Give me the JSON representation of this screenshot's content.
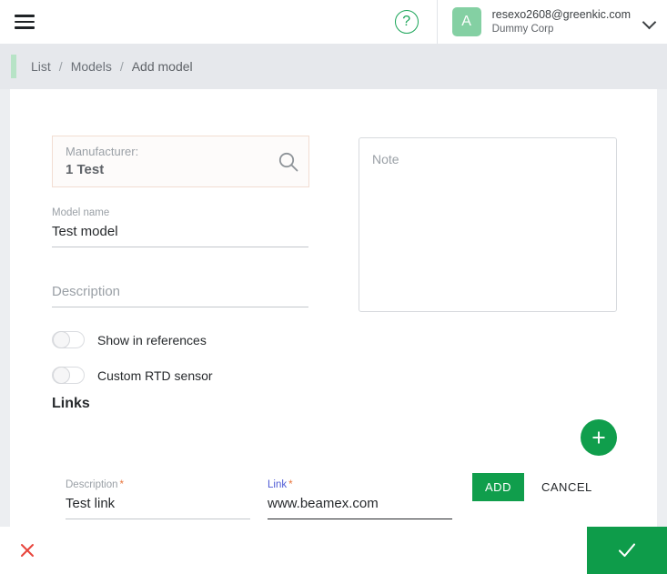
{
  "colors": {
    "brand_green": "#109e4c",
    "avatar_green": "#84d0a3",
    "accent_bar": "#b7e3c6",
    "focus_indigo": "#4f5bd5",
    "required_orange": "#e8743b",
    "danger_red": "#e8453c",
    "manufacturer_border": "#f2ddd2"
  },
  "topbar": {
    "menu_icon": "hamburger-menu-icon",
    "help_icon": "help-circle-icon",
    "help_glyph": "?",
    "avatar_initial": "A",
    "user_email": "resexo2608@greenkic.com",
    "user_org": "Dummy Corp",
    "caret_icon": "chevron-down-icon"
  },
  "breadcrumb": {
    "items": [
      {
        "label": "List"
      },
      {
        "label": "Models"
      },
      {
        "label": "Add model"
      }
    ],
    "separator": "/"
  },
  "form": {
    "manufacturer": {
      "label": "Manufacturer:",
      "value": "1 Test",
      "search_icon": "search-icon"
    },
    "model_name": {
      "label": "Model name",
      "value": "Test model",
      "placeholder": "Model name"
    },
    "description": {
      "label": "",
      "value": "Description",
      "placeholder": "Description"
    },
    "toggles": [
      {
        "label": "Show in references",
        "state": "off"
      },
      {
        "label": "Custom RTD sensor",
        "state": "off"
      }
    ],
    "links_heading": "Links",
    "note": {
      "placeholder": "Note",
      "value": ""
    },
    "add_link_fab": {
      "icon": "plus-icon",
      "label": "+"
    },
    "link_entry": {
      "description": {
        "label": "Description",
        "required_marker": "*",
        "value": "Test link"
      },
      "link": {
        "label": "Link",
        "required_marker": "*",
        "value": "www.beamex.com",
        "focused": true
      },
      "add_button": "ADD",
      "cancel_button": "CANCEL"
    }
  },
  "bottombar": {
    "cancel_icon": "close-x-icon",
    "cancel_glyph": "✕",
    "confirm_icon": "checkmark-icon"
  }
}
